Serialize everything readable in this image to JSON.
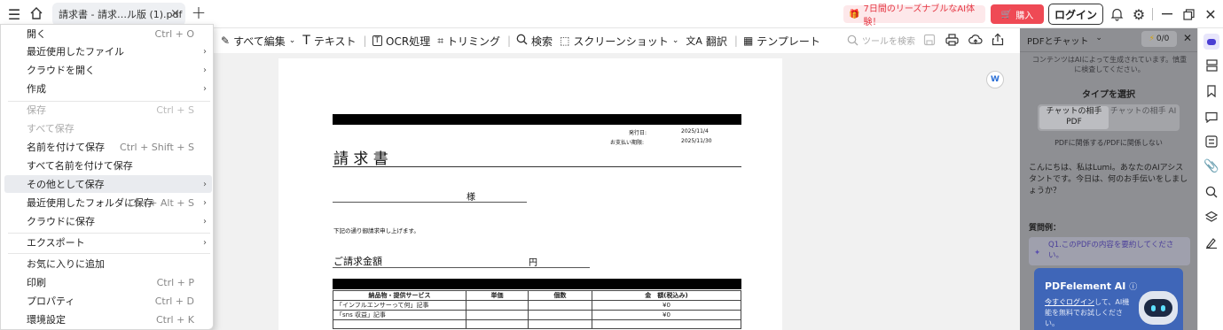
{
  "tab": {
    "title": "請求書 - 請求…ル版 (1).pdf"
  },
  "header": {
    "promo": "7日間のリーズナブルなAI体験！",
    "buy": "購入",
    "login": "ログイン"
  },
  "toolbar": {
    "edit_all": "すべて編集",
    "text": "テキスト",
    "ocr": "OCR処理",
    "trim": "トリミング",
    "search": "検索",
    "screenshot": "スクリーンショット",
    "translate": "翻訳",
    "template": "テンプレート",
    "tool_search_placeholder": "ツールを検索"
  },
  "menu": {
    "items": [
      {
        "label": "開く",
        "shortcut": "Ctrl + O",
        "arrow": ""
      },
      {
        "label": "最近使用したファイル",
        "shortcut": "",
        "arrow": "›"
      },
      {
        "label": "クラウドを開く",
        "shortcut": "",
        "arrow": "›"
      },
      {
        "label": "作成",
        "shortcut": "",
        "arrow": "›"
      },
      {
        "label": "保存",
        "shortcut": "Ctrl + S",
        "arrow": ""
      },
      {
        "label": "すべて保存",
        "shortcut": "",
        "arrow": ""
      },
      {
        "label": "名前を付けて保存",
        "shortcut": "Ctrl + Shift + S",
        "arrow": ""
      },
      {
        "label": "すべて名前を付けて保存",
        "shortcut": "",
        "arrow": ""
      },
      {
        "label": "その他として保存",
        "shortcut": "",
        "arrow": "›"
      },
      {
        "label": "最近使用したフォルダに保存",
        "shortcut": "Ctrl + Alt + S",
        "arrow": "›"
      },
      {
        "label": "クラウドに保存",
        "shortcut": "",
        "arrow": "›"
      },
      {
        "label": "エクスポート",
        "shortcut": "",
        "arrow": "›"
      },
      {
        "label": "お気に入りに追加",
        "shortcut": "",
        "arrow": ""
      },
      {
        "label": "印刷",
        "shortcut": "Ctrl + P",
        "arrow": ""
      },
      {
        "label": "プロパティ",
        "shortcut": "Ctrl + D",
        "arrow": ""
      },
      {
        "label": "環境設定",
        "shortcut": "Ctrl + K",
        "arrow": ""
      }
    ]
  },
  "document": {
    "issue_label": "発行日:",
    "issue_date": "2025/11/4",
    "due_label": "お支払い期限:",
    "due_date": "2025/11/30",
    "title": "請 求 書",
    "sama": "様",
    "intro": "下記の通り御請求申し上げます。",
    "amount_label": "ご請求金額",
    "yen": "円",
    "table_headers": [
      "納品物・提供サービス",
      "単価",
      "個数",
      "金　額(税込み)"
    ],
    "table_rows": [
      [
        "「インフルエンサーって何」記事",
        "",
        "",
        "¥0"
      ],
      [
        "「sns 収益」記事",
        "",
        "",
        "¥0"
      ],
      [
        "",
        "",
        "",
        ""
      ]
    ]
  },
  "chat": {
    "mode": "PDFとチャット",
    "counter": "0/0",
    "notice": "コンテンツはAIによって生成されています。慎重に検査してください。",
    "type_title": "タイプを選択",
    "opt1": "チャットの相手 PDF",
    "opt2": "チャットの相手 AI",
    "related": "PDFに関係する/PDFに関係しない",
    "greeting": "こんにちは、私はLumi。あなたのAIアシスタントです。今日は、何のお手伝いをしましょうか？",
    "examples_label": "質問例：",
    "q1": "Q1.このPDFの内容を要約してください。",
    "promo_title": "PDFelement AI",
    "promo_link": "今すぐログイン",
    "promo_body": "して、AI機能を無料でお試しください。"
  }
}
